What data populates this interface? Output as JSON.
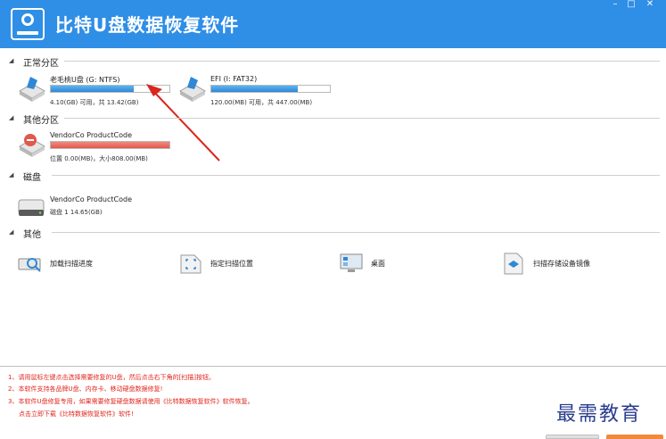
{
  "app": {
    "title": "比特U盘数据恢复软件"
  },
  "window_controls": {
    "minimize": "–",
    "maximize": "□",
    "close": "✕"
  },
  "sections": {
    "normal_partition": "正常分区",
    "other_partition": "其他分区",
    "disk": "磁盘",
    "other": "其他"
  },
  "drives": [
    {
      "name": "老毛桃U盘 (G: NTFS)",
      "meta": "4.10(GB) 可用，共 13.42(GB)",
      "fill_fraction": 0.7,
      "color": "#2f88d6",
      "icon": "usb-drive-icon"
    },
    {
      "name": "EFI (I: FAT32)",
      "meta": "120.00(MB) 可用，共 447.00(MB)",
      "fill_fraction": 0.73,
      "color": "#2f88d6",
      "icon": "usb-drive-icon"
    }
  ],
  "other_partitions": [
    {
      "name": "VendorCo ProductCode",
      "meta": "位置 0.00(MB)，大小808.00(MB)",
      "fill_fraction": 1.0,
      "color": "#e2584b",
      "icon": "error-drive-icon"
    }
  ],
  "disks": [
    {
      "name": "VendorCo ProductCode",
      "meta": "磁盘 1    14.65(GB)",
      "icon": "hard-disk-icon"
    }
  ],
  "tools": [
    {
      "label": "加载扫描进度",
      "icon": "load-scan-icon"
    },
    {
      "label": "指定扫描位置",
      "icon": "scan-location-icon"
    },
    {
      "label": "桌面",
      "icon": "desktop-icon"
    },
    {
      "label": "扫描存储设备镜像",
      "icon": "disk-image-icon"
    }
  ],
  "notes": [
    "1、请用鼠标左键点击选择需要修复的U盘，然后点击右下角的[扫描]按钮。",
    "2、本软件支持各品牌U盘、内存卡、移动硬盘数据修复!",
    "3、本软件U盘修复专用，如果需要修复硬盘数据请使用《比特数据恢复软件》软件恢复。",
    "点击立即下载《比特数据恢复软件》软件!"
  ],
  "watermark": "最需教育",
  "colors": {
    "titlebar": "#2f8ee6",
    "progress_blue": "#2f88d6",
    "progress_red": "#e2584b",
    "note_red": "#e0261e",
    "watermark": "#2a3d8f"
  }
}
